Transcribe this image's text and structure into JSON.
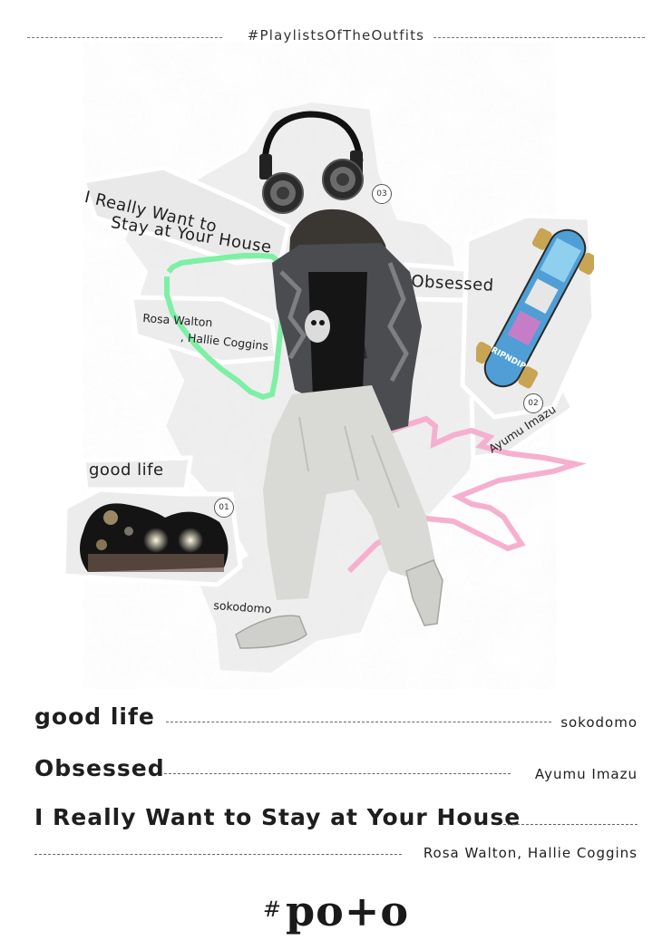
{
  "header": {
    "hashtag": "#PlaylistsOfTheOutfits"
  },
  "collage": {
    "label_house_line1": "I Really Want to",
    "label_house_line2": "Stay at Your House",
    "label_obsessed": "Obsessed",
    "label_rosa_line1": "Rosa Walton",
    "label_rosa_line2": ", Hallie Coggins",
    "label_good_life": "good life",
    "label_sokodomo": "sokodomo",
    "label_ayumu": "Ayumu Imazu",
    "badge_01": "01",
    "badge_02": "02",
    "badge_03": "03",
    "skateboard_text": "RIPNDIP"
  },
  "tracks": [
    {
      "title": "good life",
      "artist": "sokodomo"
    },
    {
      "title": "Obsessed",
      "artist": "Ayumu Imazu"
    },
    {
      "title": "I Really Want to Stay at Your House",
      "artist": "Rosa Walton, Hallie Coggins"
    }
  ],
  "logo": {
    "hash": "#",
    "text": "po+o"
  },
  "colors": {
    "green_pixel": "#7ef0a6",
    "pink_pixel": "#f6b0cf",
    "paper": "#ececec"
  }
}
